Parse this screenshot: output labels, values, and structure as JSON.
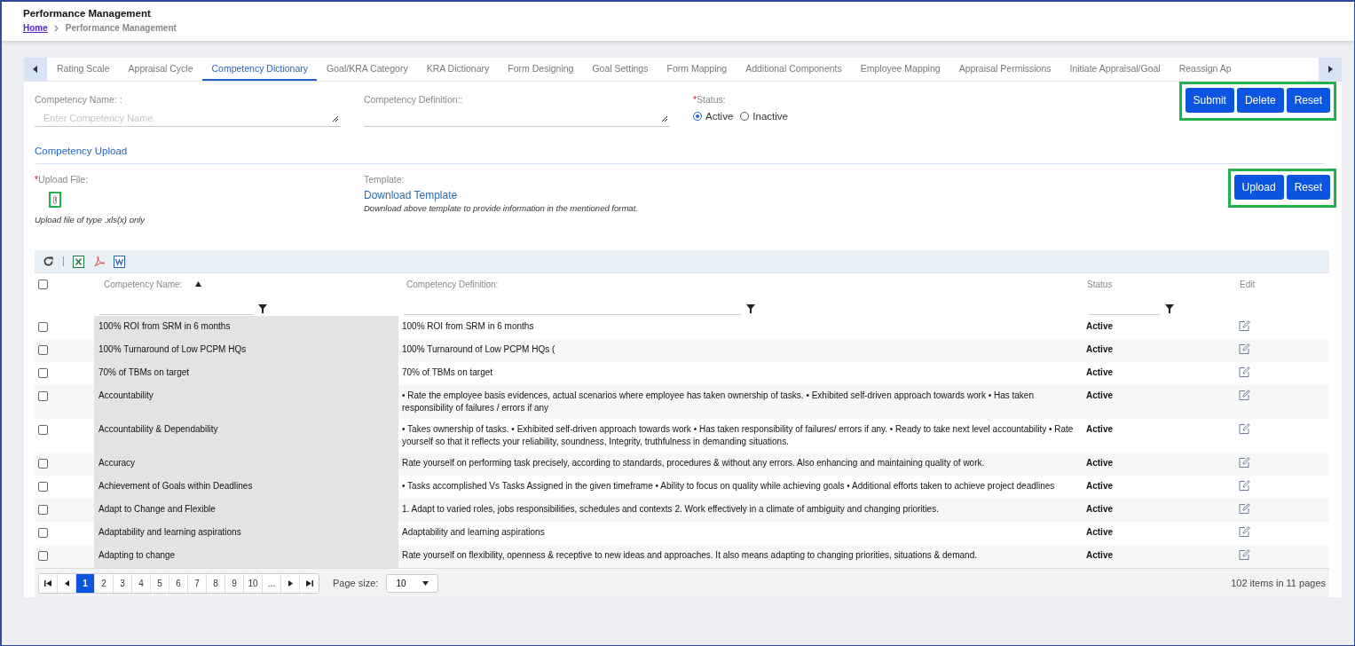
{
  "window": {
    "title": "Performance Management"
  },
  "breadcrumb": [
    {
      "label": "Home",
      "kind": "link"
    },
    {
      "label": "Performance Management",
      "kind": "current"
    }
  ],
  "tabs": [
    {
      "label": "Rating Scale",
      "selected": false
    },
    {
      "label": "Appraisal Cycle",
      "selected": false
    },
    {
      "label": "Competency Dictionary",
      "selected": true
    },
    {
      "label": "Goal/KRA Category",
      "selected": false
    },
    {
      "label": "KRA Dictionary",
      "selected": false
    },
    {
      "label": "Form Designing",
      "selected": false
    },
    {
      "label": "Goal Settings",
      "selected": false
    },
    {
      "label": "Form Mapping",
      "selected": false
    },
    {
      "label": "Additional Components",
      "selected": false
    },
    {
      "label": "Employee Mapping",
      "selected": false
    },
    {
      "label": "Appraisal Permissions",
      "selected": false
    },
    {
      "label": "Initiate Appraisal/Goal",
      "selected": false
    },
    {
      "label": "Reassign Ap",
      "selected": false
    }
  ],
  "form": {
    "name_field": {
      "label": "Competency Name: :",
      "placeholder": "Enter Competency Name."
    },
    "definition_field": {
      "label": "Competency Definition::"
    },
    "status": {
      "label": "Status:",
      "required_mark": "*",
      "options": [
        {
          "label": "Active",
          "selected": true
        },
        {
          "label": "Inactive",
          "selected": false
        }
      ]
    },
    "buttons": [
      "Submit",
      "Delete",
      "Reset"
    ],
    "highlighted": true
  },
  "upload": {
    "section_title": "Competency Upload",
    "file_label": "Upload File:",
    "required_mark": "*",
    "icon_highlighted": true,
    "hint": "Upload file of type .xls(x) only",
    "template_label": "Template:",
    "template_link": "Download Template",
    "template_note": "Download above template to provide information in the mentioned format.",
    "buttons": [
      "Upload",
      "Reset"
    ],
    "highlighted": true
  },
  "grid": {
    "all_checked": false,
    "columns": [
      {
        "label": "Competency Name:",
        "sorted": true,
        "filter": true
      },
      {
        "label": "Competency Definition:",
        "sorted": false,
        "filter": true
      },
      {
        "label": "Status",
        "sorted": false,
        "filter": true
      },
      {
        "label": "Edit",
        "sorted": false,
        "filter": false
      }
    ],
    "rows": [
      {
        "name": "100% ROI from SRM in 6 months",
        "definition": "100% ROI from SRM in 6 months",
        "status": "Active",
        "checked": false
      },
      {
        "name": "100% Turnaround of Low PCPM HQs",
        "definition": "100% Turnaround of Low PCPM HQs (",
        "status": "Active",
        "checked": false
      },
      {
        "name": "70% of TBMs on target",
        "definition": "70% of TBMs on target",
        "status": "Active",
        "checked": false
      },
      {
        "name": "Accountability",
        "definition": "• Rate the employee basis evidences, actual scenarios where employee has taken ownership of tasks. • Exhibited self-driven approach towards work • Has taken responsibility of failures / errors if any",
        "status": "Active",
        "checked": false
      },
      {
        "name": "Accountability & Dependability",
        "definition": "• Takes ownership of tasks. • Exhibited self-driven approach towards work • Has taken responsibility of failures/ errors if any. • Ready to take next level accountability • Rate yourself so that it reflects your reliability, soundness, Integrity, truthfulness in demanding situations.",
        "status": "Active",
        "checked": false
      },
      {
        "name": "Accuracy",
        "definition": "Rate yourself on performing task precisely, according to standards, procedures & without any errors. Also enhancing and maintaining quality of work.",
        "status": "Active",
        "checked": false
      },
      {
        "name": "Achievement of Goals within Deadlines",
        "definition": "• Tasks accomplished Vs Tasks Assigned in the given timeframe • Ability to focus on quality while achieving goals • Additional efforts taken to achieve project deadlines",
        "status": "Active",
        "checked": false
      },
      {
        "name": "Adapt to Change and Flexible",
        "definition": "1. Adapt to varied roles, jobs responsibilities, schedules and contexts 2. Work effectively in a climate of ambiguity and changing priorities.",
        "status": "Active",
        "checked": false
      },
      {
        "name": "Adaptability and learning aspirations",
        "definition": "Adaptability and learning aspirations",
        "status": "Active",
        "checked": false
      },
      {
        "name": "Adapting to change",
        "definition": "Rate yourself on flexibility, openness & receptive to new ideas and approaches. It also means adapting to changing priorities, situations & demand.",
        "status": "Active",
        "checked": false
      }
    ],
    "pages": [
      {
        "label": "1",
        "selected": true
      },
      {
        "label": "2",
        "selected": false
      },
      {
        "label": "3",
        "selected": false
      },
      {
        "label": "4",
        "selected": false
      },
      {
        "label": "5",
        "selected": false
      },
      {
        "label": "6",
        "selected": false
      },
      {
        "label": "7",
        "selected": false
      },
      {
        "label": "8",
        "selected": false
      },
      {
        "label": "9",
        "selected": false
      },
      {
        "label": "10",
        "selected": false
      },
      {
        "label": "...",
        "selected": false
      }
    ],
    "page_size_label": "Page size:",
    "page_size": "10",
    "summary": "102 items in 11 pages"
  }
}
